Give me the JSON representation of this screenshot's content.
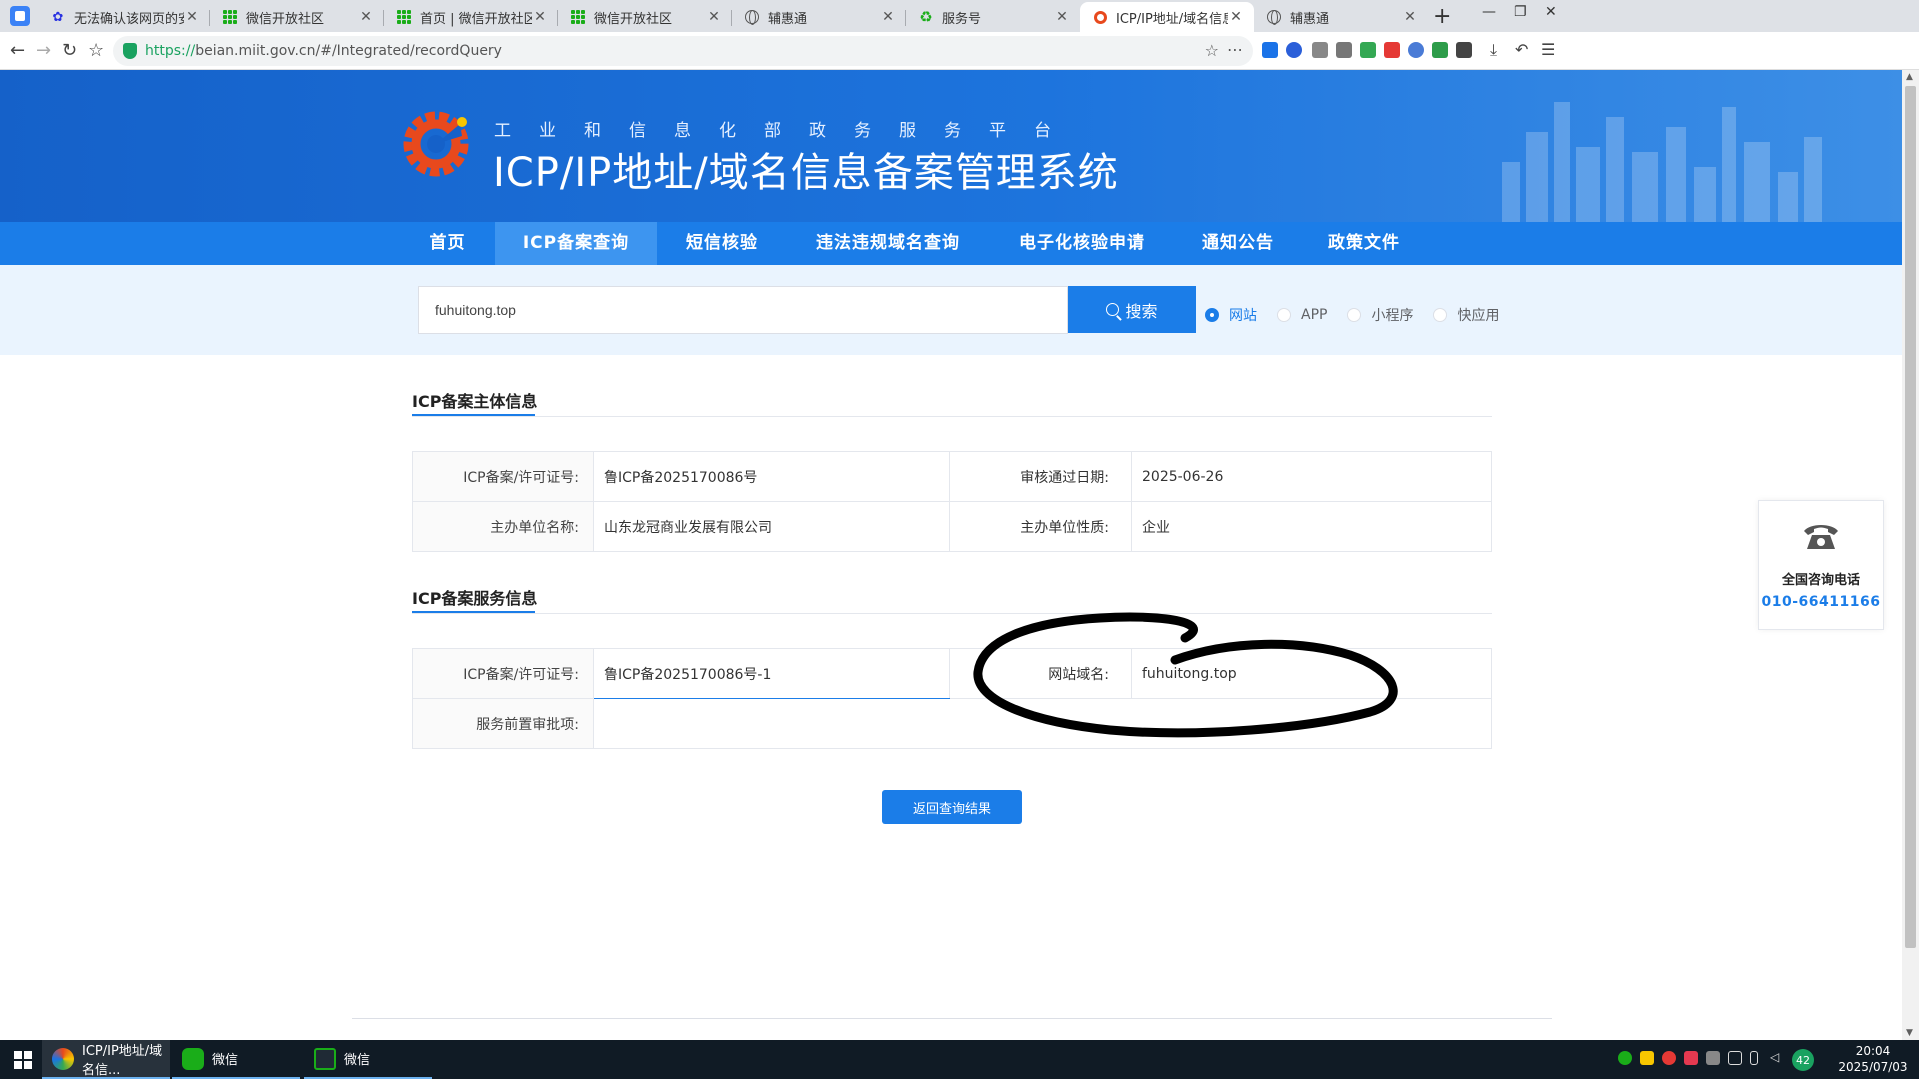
{
  "browser": {
    "tabs": [
      {
        "title": "无法确认该网页的安全性,请",
        "icon": "baidu-paw-icon"
      },
      {
        "title": "微信开放社区",
        "icon": "wechat-grid-icon"
      },
      {
        "title": "首页 | 微信开放社区",
        "icon": "wechat-grid-icon"
      },
      {
        "title": "微信开放社区",
        "icon": "wechat-grid-icon"
      },
      {
        "title": "辅惠通",
        "icon": "globe-icon"
      },
      {
        "title": "服务号",
        "icon": "wechat-service-icon"
      },
      {
        "title": "ICP/IP地址/域名信息备案管",
        "icon": "miit-logo-icon"
      },
      {
        "title": "辅惠通",
        "icon": "globe-icon"
      }
    ],
    "url_scheme": "https://",
    "url_rest": "beian.miit.gov.cn/#/Integrated/recordQuery"
  },
  "header": {
    "subtitle": "工业和信息化部政务服务平台",
    "title": "ICP/IP地址/域名信息备案管理系统"
  },
  "nav": [
    "首页",
    "ICP备案查询",
    "短信核验",
    "违法违规域名查询",
    "电子化核验申请",
    "通知公告",
    "政策文件"
  ],
  "search": {
    "value": "fuhuitong.top",
    "button": "搜索",
    "options": [
      "网站",
      "APP",
      "小程序",
      "快应用"
    ],
    "selected": "网站"
  },
  "subject_info": {
    "title": "ICP备案主体信息",
    "license_label": "ICP备案/许可证号:",
    "license_value": "鲁ICP备2025170086号",
    "date_label": "审核通过日期:",
    "date_value": "2025-06-26",
    "org_label": "主办单位名称:",
    "org_value": "山东龙冠商业发展有限公司",
    "nature_label": "主办单位性质:",
    "nature_value": "企业"
  },
  "service_info": {
    "title": "ICP备案服务信息",
    "license_label": "ICP备案/许可证号:",
    "license_value": "鲁ICP备2025170086号-1",
    "domain_label": "网站域名:",
    "domain_value": "fuhuitong.top",
    "approval_label": "服务前置审批项:",
    "approval_value": ""
  },
  "back_button": "返回查询结果",
  "consult": {
    "title": "全国咨询电话",
    "phone": "010-66411166"
  },
  "taskbar": {
    "tasks": [
      "ICP/IP地址/域名信...",
      "微信",
      "微信"
    ],
    "tray_badge": "42",
    "time": "20:04",
    "date": "2025/07/03"
  },
  "colors": {
    "primary": "#1b7de8",
    "banner": "#1561c9",
    "annotation": "#000000"
  }
}
